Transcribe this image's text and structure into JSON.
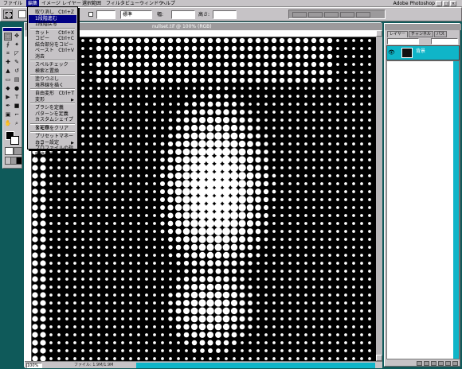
{
  "menubar": {
    "items": [
      "ファイル",
      "編集",
      "イメージ",
      "レイヤー",
      "選択範囲",
      "フィルタ",
      "ビュー",
      "ウィンドウ",
      "ヘルプ"
    ],
    "active_index": 1,
    "title_info": "Adobe Photoshop"
  },
  "options": {
    "style_value": "標準",
    "width_label": "幅:",
    "height_label": "高さ:"
  },
  "document": {
    "title": "nullset.tif @ 100% (RGB)",
    "zoom": "100%",
    "info": "ファイル: 1.9M/1.9M"
  },
  "menu": {
    "items": [
      {
        "label": "取り消し",
        "shortcut": "Ctrl+Z"
      },
      {
        "label": "1段階進む",
        "shortcut": ""
      },
      {
        "label": "1段階戻る",
        "shortcut": ""
      },
      {
        "label": "カット",
        "shortcut": "Ctrl+X"
      },
      {
        "label": "コピー",
        "shortcut": "Ctrl+C"
      },
      {
        "label": "結合部分をコピー",
        "shortcut": ""
      },
      {
        "label": "ペースト",
        "shortcut": "Ctrl+V"
      },
      {
        "label": "消去",
        "shortcut": ""
      },
      {
        "label": "スペルチェック",
        "shortcut": ""
      },
      {
        "label": "検索と置換",
        "shortcut": ""
      },
      {
        "label": "塗りつぶし",
        "shortcut": ""
      },
      {
        "label": "境界線を描く",
        "shortcut": ""
      },
      {
        "label": "自由変形",
        "shortcut": "Ctrl+T"
      },
      {
        "label": "変形",
        "shortcut": ""
      },
      {
        "label": "ブラシを定義",
        "shortcut": ""
      },
      {
        "label": "パターンを定義",
        "shortcut": ""
      },
      {
        "label": "カスタムシェイプを定義",
        "shortcut": ""
      },
      {
        "label": "メモリをクリア",
        "shortcut": ""
      },
      {
        "label": "プリセットマネージャ",
        "shortcut": ""
      },
      {
        "label": "カラー設定",
        "shortcut": ""
      },
      {
        "label": "プロファイルの指定",
        "shortcut": ""
      },
      {
        "label": "環境設定",
        "shortcut": ""
      }
    ],
    "highlighted_index": 1
  },
  "layers": {
    "tabs": [
      "レイヤー",
      "チャンネル",
      "パス"
    ],
    "active_tab": 0,
    "layer_name": "背景"
  },
  "icons": {
    "eye": "eye-icon",
    "marquee": "marquee-icon",
    "move": "move-icon",
    "lasso": "lasso-icon",
    "wand": "wand-icon",
    "crop": "crop-icon",
    "brush": "brush-icon",
    "eraser": "eraser-icon",
    "hand": "hand-icon",
    "zoom": "zoom-icon"
  },
  "colors": {
    "desktop": "#0f5a5a",
    "chrome": "#c6c3c6",
    "highlight": "#000084",
    "accent_cyan": "#0fb5c8"
  }
}
